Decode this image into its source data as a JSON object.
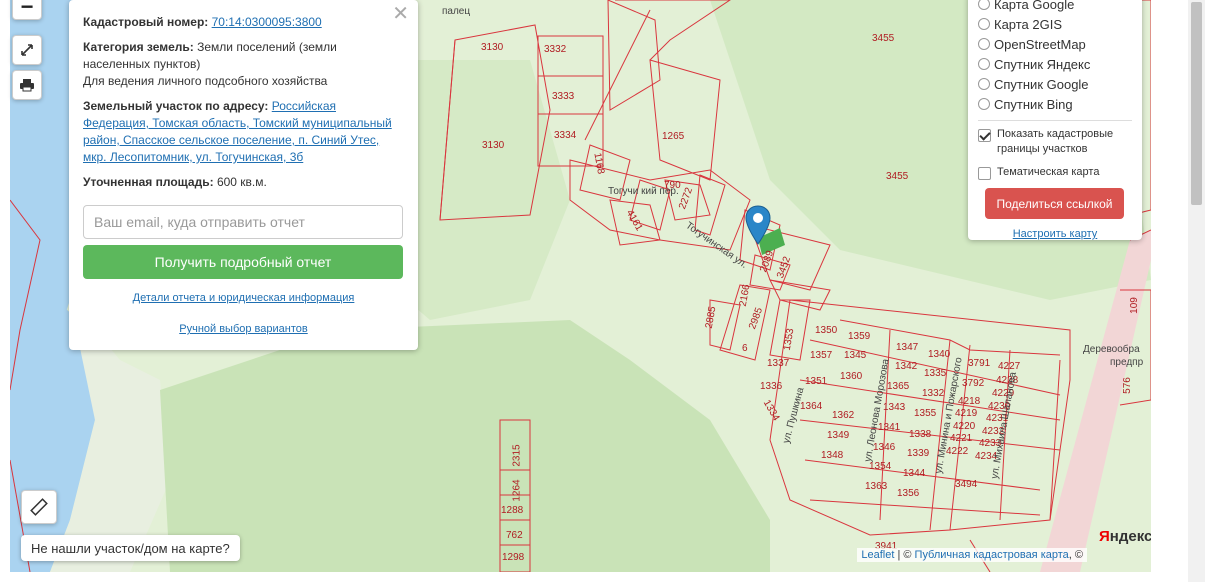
{
  "panel": {
    "cadastral_label": "Кадастровый номер:",
    "cadastral_number": "70:14:0300095:3800",
    "category_label": "Категория земель:",
    "category_value": "Земли поселений (земли населенных пунктов)",
    "usage": "Для ведения личного подсобного хозяйства",
    "address_label": "Земельный участок по адресу:",
    "address_value": "Российская Федерация, Томская область, Томский муниципальный район, Спасское сельское поселение, п. Синий Утес, мкр. Лесопитомник, ул. Тогучинская, 3б",
    "area_label": "Уточненная площадь:",
    "area_value": "600 кв.м.",
    "email_placeholder": "Ваш email, куда отправить отчет",
    "report_button": "Получить подробный отчет",
    "details_link": "Детали отчета и юридическая информация",
    "manual_link": "Ручной выбор вариантов",
    "close": "✕"
  },
  "layers": {
    "options": [
      "Карта Google",
      "Карта 2GIS",
      "OpenStreetMap",
      "Спутник Яндекс",
      "Спутник Google",
      "Спутник Bing"
    ],
    "show_borders": "Показать кадастровые границы участков",
    "thematic": "Тематическая карта",
    "share_button": "Поделиться ссылкой",
    "setup_link": "Настроить карту"
  },
  "not_found_button": "Не нашли участок/дом на карте?",
  "attribution": {
    "leaflet": "Leaflet",
    "sep": "| ©",
    "pkk": "Публичная кадастровая карта",
    "tail": ", ©"
  },
  "yandex_logo": {
    "first": "Я",
    "rest": "ндекс"
  },
  "map": {
    "labels": {
      "l3130a": "3130",
      "l3332": "3332",
      "l3333": "3333",
      "l3334": "3334",
      "l3130b": "3130",
      "l1265": "1265",
      "l1168": "1168",
      "l3455a": "3455",
      "l3455b": "3455",
      "l4161": "4161",
      "l2272": "2272",
      "l790": "790",
      "l2089": "2089",
      "l3452": "3452",
      "l2166": "2166",
      "l2885": "2885",
      "l2985": "2985",
      "l1353": "1353",
      "l1350": "1350",
      "l1359": "1359",
      "l1357": "1357",
      "l1345": "1345",
      "l1347": "1347",
      "l1340": "1340",
      "l1337": "1337",
      "l1360": "1360",
      "l1342": "1342",
      "l1335": "1335",
      "l1336": "1336",
      "l1351": "1351",
      "l1365": "1365",
      "l1332": "1332",
      "l1364": "1364",
      "l1362": "1362",
      "l1343": "1343",
      "l1355": "1355",
      "l1334": "1334",
      "l1341": "1341",
      "l1338": "1338",
      "l1349": "1349",
      "l1346": "1346",
      "l1339": "1339",
      "l1348": "1348",
      "l1344": "1344",
      "l1354": "1354",
      "l1363": "1363",
      "l1356": "1356",
      "l3791": "3791",
      "l4227": "4227",
      "l3792": "3792",
      "l4228": "4228",
      "l4229": "4229",
      "l4218": "4218",
      "l4230": "4230",
      "l4219": "4219",
      "l4231": "4231",
      "l4220": "4220",
      "l4232": "4232",
      "l4221": "4221",
      "l4233": "4233",
      "l4222": "4222",
      "l4234": "4234",
      "l3494": "3494",
      "l2315": "2315",
      "l1264": "1264",
      "l1288": "1288",
      "l762": "762",
      "l1298": "1298",
      "l3941": "3941",
      "l576": "576",
      "l109": "109",
      "l6": "6"
    },
    "streets": {
      "togucha_top": "Тогучи кий пер.",
      "togucha": "Тогучинская ул.",
      "pushkina": "ул. Пушкина",
      "morozova": "ул. Леонова Морозова",
      "minina": "ул. Минина и Пожарского",
      "novikova": "ул. Михаила Шаланова",
      "bolshoi": "палец",
      "derevo": "Деревообра",
      "derevo2": "предпр"
    }
  },
  "colors": {
    "parcel": "#d9363e",
    "water": "#aad3f0",
    "forest": "#c9e3b7",
    "selected": "#4caf50"
  }
}
